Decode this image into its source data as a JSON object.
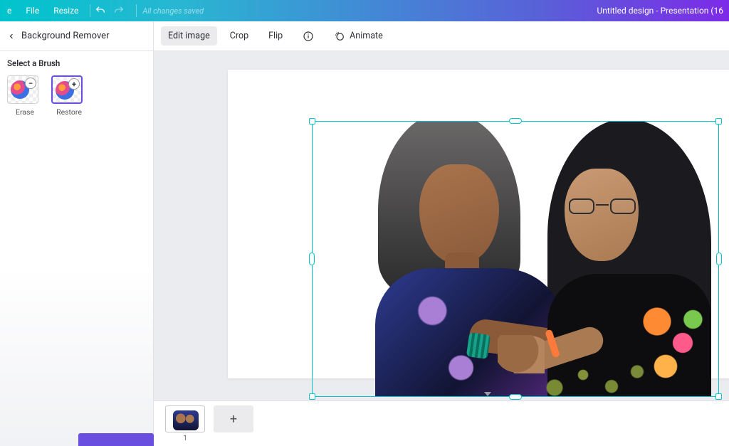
{
  "topbar": {
    "home_label": "e",
    "file_label": "File",
    "resize_label": "Resize",
    "saved_status": "All changes saved",
    "doc_title": "Untitled design - Presentation (16"
  },
  "toolbar": {
    "panel_title": "Background Remover",
    "edit_image": "Edit image",
    "crop": "Crop",
    "flip": "Flip",
    "animate": "Animate"
  },
  "sidepanel": {
    "section": "Select a Brush",
    "brushes": [
      {
        "label": "Erase",
        "badge": "−",
        "selected": false
      },
      {
        "label": "Restore",
        "badge": "+",
        "selected": true
      }
    ]
  },
  "pages": {
    "current_number": "1"
  }
}
